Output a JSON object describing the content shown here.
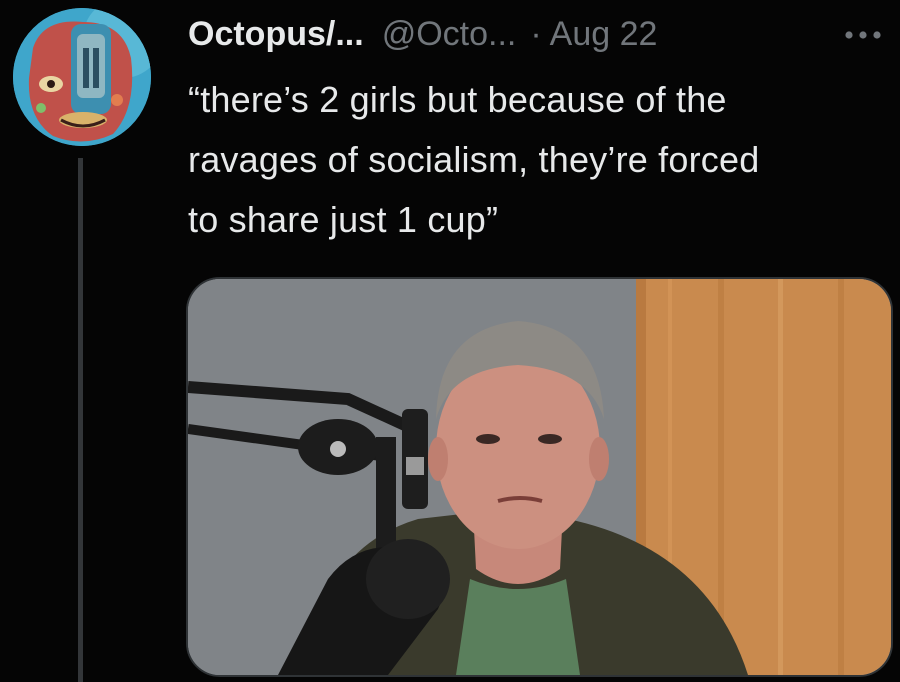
{
  "tweet": {
    "display_name": "Octopus/...",
    "handle": "@Octo...",
    "separator": "·",
    "timestamp": "Aug 22",
    "text_lines": [
      "“there’s 2 girls but because of the",
      "ravages of socialism, they’re forced",
      "to share just 1 cup”"
    ]
  },
  "icons": {
    "more": "more-horizontal-icon",
    "avatar": "profile-avatar",
    "media": "attached-photo"
  },
  "colors": {
    "background": "#050505",
    "primary_text": "#e7e9ea",
    "secondary_text": "#71767b",
    "thread_line": "#333639",
    "media_border": "#2f3336"
  }
}
